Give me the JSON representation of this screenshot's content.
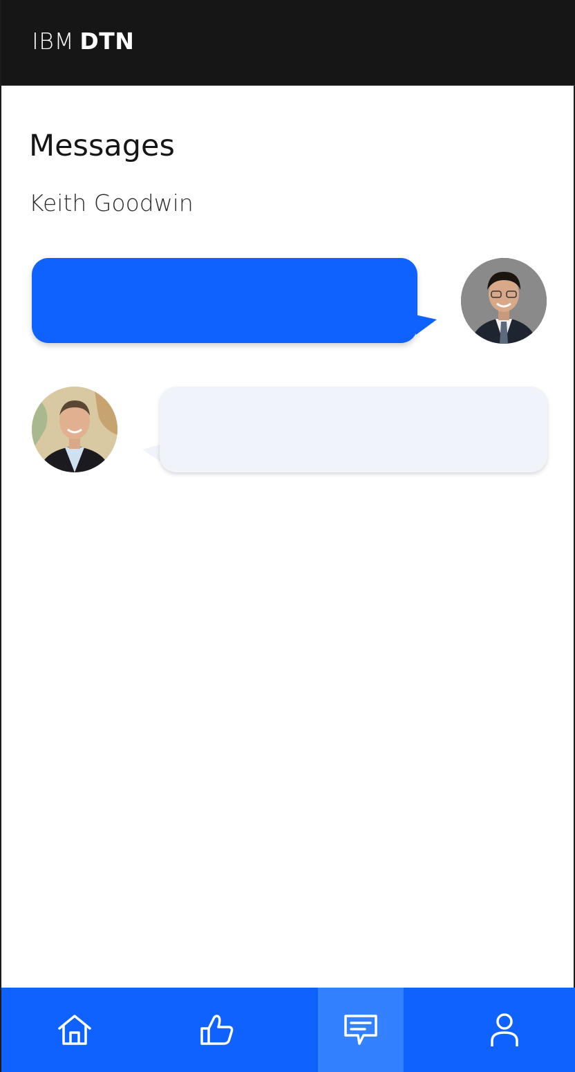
{
  "app": {
    "brand_prefix": "IBM",
    "brand_name": "DTN"
  },
  "page": {
    "title": "Messages",
    "contact_name": "Keith Goodwin"
  },
  "messages": [
    {
      "direction": "outgoing",
      "text": ""
    },
    {
      "direction": "incoming",
      "text": ""
    }
  ],
  "colors": {
    "header_bg": "#161616",
    "accent": "#0f62fe",
    "nav_active": "#3381ff",
    "incoming_bubble": "#f0f3f9"
  },
  "nav": {
    "items": [
      {
        "icon": "home-icon",
        "active": false
      },
      {
        "icon": "thumbs-up-icon",
        "active": false
      },
      {
        "icon": "chat-icon",
        "active": true
      },
      {
        "icon": "user-icon",
        "active": false
      }
    ]
  }
}
